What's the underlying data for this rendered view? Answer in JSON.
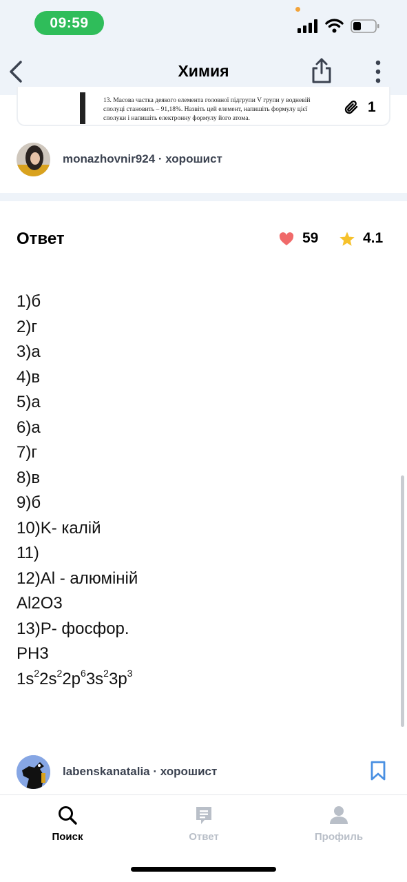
{
  "status_bar": {
    "time": "09:59"
  },
  "nav": {
    "title": "Химия"
  },
  "question": {
    "attachment_text": "13. Масова частка деякого елемента головної підгрупи V групи у водневій сполуці становить – 91,18%. Назвіть цей елемент, напишіть формулу цієї сполуки і напишіть електронну формулу його атома.",
    "attachment_count": "1"
  },
  "asker": {
    "username": "monazhovnir924",
    "separator": " · ",
    "rank": "хорошист"
  },
  "answer": {
    "heading": "Ответ",
    "likes": "59",
    "rating": "4.1",
    "lines": [
      "1)б",
      "2)г",
      "3)а",
      "4)в",
      "5)а",
      "6)а",
      "7)г",
      "8)в",
      "9)б",
      "10)K- калій",
      "11)",
      "12)Al - алюміній",
      "Al2O3",
      "13)P- фосфор.",
      "PH3"
    ],
    "electron_formula": [
      "1s",
      "2",
      "2s",
      "2",
      "2p",
      "6",
      "3s",
      "2",
      "3p",
      "3"
    ]
  },
  "answerer": {
    "username": "labenskanatalia",
    "separator": " · ",
    "rank": "хорошист"
  },
  "tabs": [
    {
      "label": "Поиск",
      "icon": "search-icon",
      "active": true
    },
    {
      "label": "Ответ",
      "icon": "answer-icon",
      "active": false
    },
    {
      "label": "Профиль",
      "icon": "profile-icon",
      "active": false
    }
  ],
  "colors": {
    "accent_green": "#2fbd5a",
    "heart": "#f06a6a",
    "star": "#f6c12b",
    "bookmark": "#4a90e2",
    "inactive_tab": "#b9bfc8"
  }
}
